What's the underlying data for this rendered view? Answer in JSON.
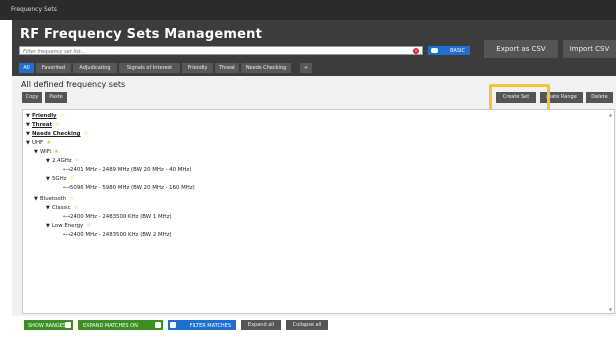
{
  "window": {
    "title": "Frequency Sets"
  },
  "app": {
    "title": "RF Frequency Sets Management"
  },
  "filter": {
    "placeholder": "Filter frequency set list...",
    "clear_icon": "close-icon"
  },
  "mode_toggle": {
    "label": "BASIC"
  },
  "header_buttons": {
    "export_label": "Export as CSV",
    "import_label": "Import CSV"
  },
  "tabs": [
    {
      "label": "All",
      "active": true
    },
    {
      "label": "Favorited"
    },
    {
      "label": "Adjudicating"
    },
    {
      "label": "Signals of Interest"
    },
    {
      "label": "Friendly"
    },
    {
      "label": "Threat"
    },
    {
      "label": "Needs Checking"
    },
    {
      "label": "+"
    }
  ],
  "panel": {
    "title": "All defined frequency sets",
    "copy_label": "Copy",
    "paste_label": "Paste",
    "create_label": "Create Set",
    "create_range_label": "reate Range",
    "delete_label": "Delete"
  },
  "tree": [
    {
      "label": "Friendly",
      "star": "☆"
    },
    {
      "label": "Threat",
      "star": "☆"
    },
    {
      "label": "Needs Checking",
      "star": "☆"
    },
    {
      "label": "UHF",
      "star": "★"
    },
    {
      "label": "WiFi",
      "star": "★"
    },
    {
      "label": "2.4GHz",
      "star": "☆"
    },
    {
      "label": "2401 MHz - 2489 MHz (BW 20 MHz - 40 MHz)"
    },
    {
      "label": "5GHz",
      "star": "☆"
    },
    {
      "label": "5096 MHz - 5980 MHz (BW 20 MHz - 160 MHz)"
    },
    {
      "label": "Bluetooth",
      "star": "☆"
    },
    {
      "label": "Classic",
      "star": "☆"
    },
    {
      "label": "2400 MHz - 2483500 KHz (BW 1 MHz)"
    },
    {
      "label": "Low Energy",
      "star": "☆"
    },
    {
      "label": "2400 MHz - 2483500 KHz (BW 2 MHz)"
    }
  ],
  "footer": {
    "show_ranges_label": "SHOW RANGES",
    "expand_matches_label": "EXPAND MATCHES ON",
    "filter_matches_label": "FILTER MATCHES",
    "expand_all_label": "Expand all",
    "collapse_all_label": "Collapse all"
  },
  "colors": {
    "accent_blue": "#1e6fcf",
    "toggle_green": "#3d8f24",
    "highlight_yellow": "#f6c431",
    "dark_bg": "#3c3c3c"
  }
}
